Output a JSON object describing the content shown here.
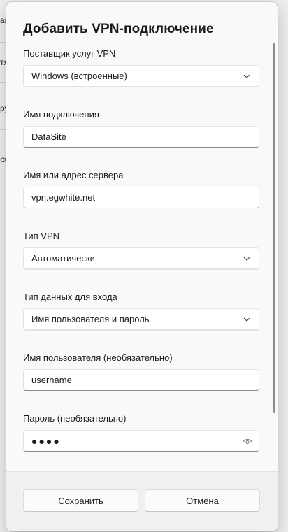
{
  "background": {
    "fragments": [
      "ам",
      "тя",
      "ру",
      "Ф"
    ]
  },
  "dialog": {
    "title": "Добавить VPN-подключение",
    "fields": {
      "provider": {
        "label": "Поставщик услуг VPN",
        "value": "Windows (встроенные)"
      },
      "connection_name": {
        "label": "Имя подключения",
        "value": "DataSite"
      },
      "server": {
        "label": "Имя или адрес сервера",
        "value": "vpn.egwhite.net"
      },
      "vpn_type": {
        "label": "Тип VPN",
        "value": "Автоматически"
      },
      "signin_type": {
        "label": "Тип данных для входа",
        "value": "Имя пользователя и пароль"
      },
      "username": {
        "label": "Имя пользователя (необязательно)",
        "value": "username"
      },
      "password": {
        "label": "Пароль (необязательно)",
        "value": "●●●●"
      }
    },
    "buttons": {
      "save": "Сохранить",
      "cancel": "Отмена"
    }
  },
  "icons": {
    "dropdown": "chevron-down-icon",
    "reveal": "eye-icon"
  }
}
